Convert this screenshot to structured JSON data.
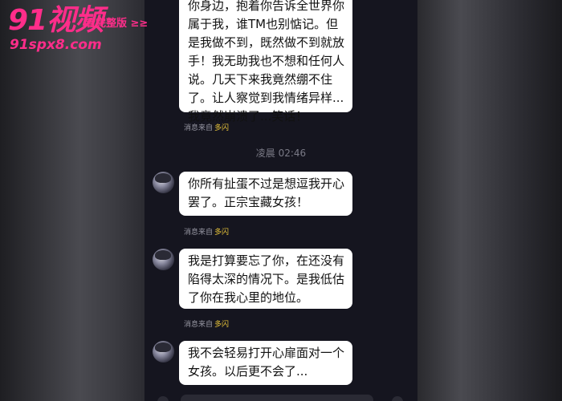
{
  "watermark": {
    "logo": "91视频",
    "tagline": "看完整版 ≥≥",
    "url": "91spx8.com"
  },
  "timestamp": "凌晨 02:46",
  "messages": [
    {
      "text": "你身边，抱着你告诉全世界你属于我，谁TM也别惦记。但是我做不到，既然做不到就放手！我无助我也不想和任何人说。几天下来我竟然绷不住了。让人察觉到我情绪异样...我竟然崩溃了...笑话！",
      "source_prefix": "消息来自",
      "source_app": "多闪"
    },
    {
      "text": "你所有扯蛋不过是想逗我开心罢了。正宗宝藏女孩！",
      "source_prefix": "消息来自",
      "source_app": "多闪"
    },
    {
      "text": "我是打算要忘了你，在还没有陷得太深的情况下。是我低估了你在我心里的地位。",
      "source_prefix": "消息来自",
      "source_app": "多闪"
    },
    {
      "text": "我不会轻易打开心扉面对一个女孩。以后更不会了...",
      "source_prefix": "",
      "source_app": ""
    }
  ]
}
